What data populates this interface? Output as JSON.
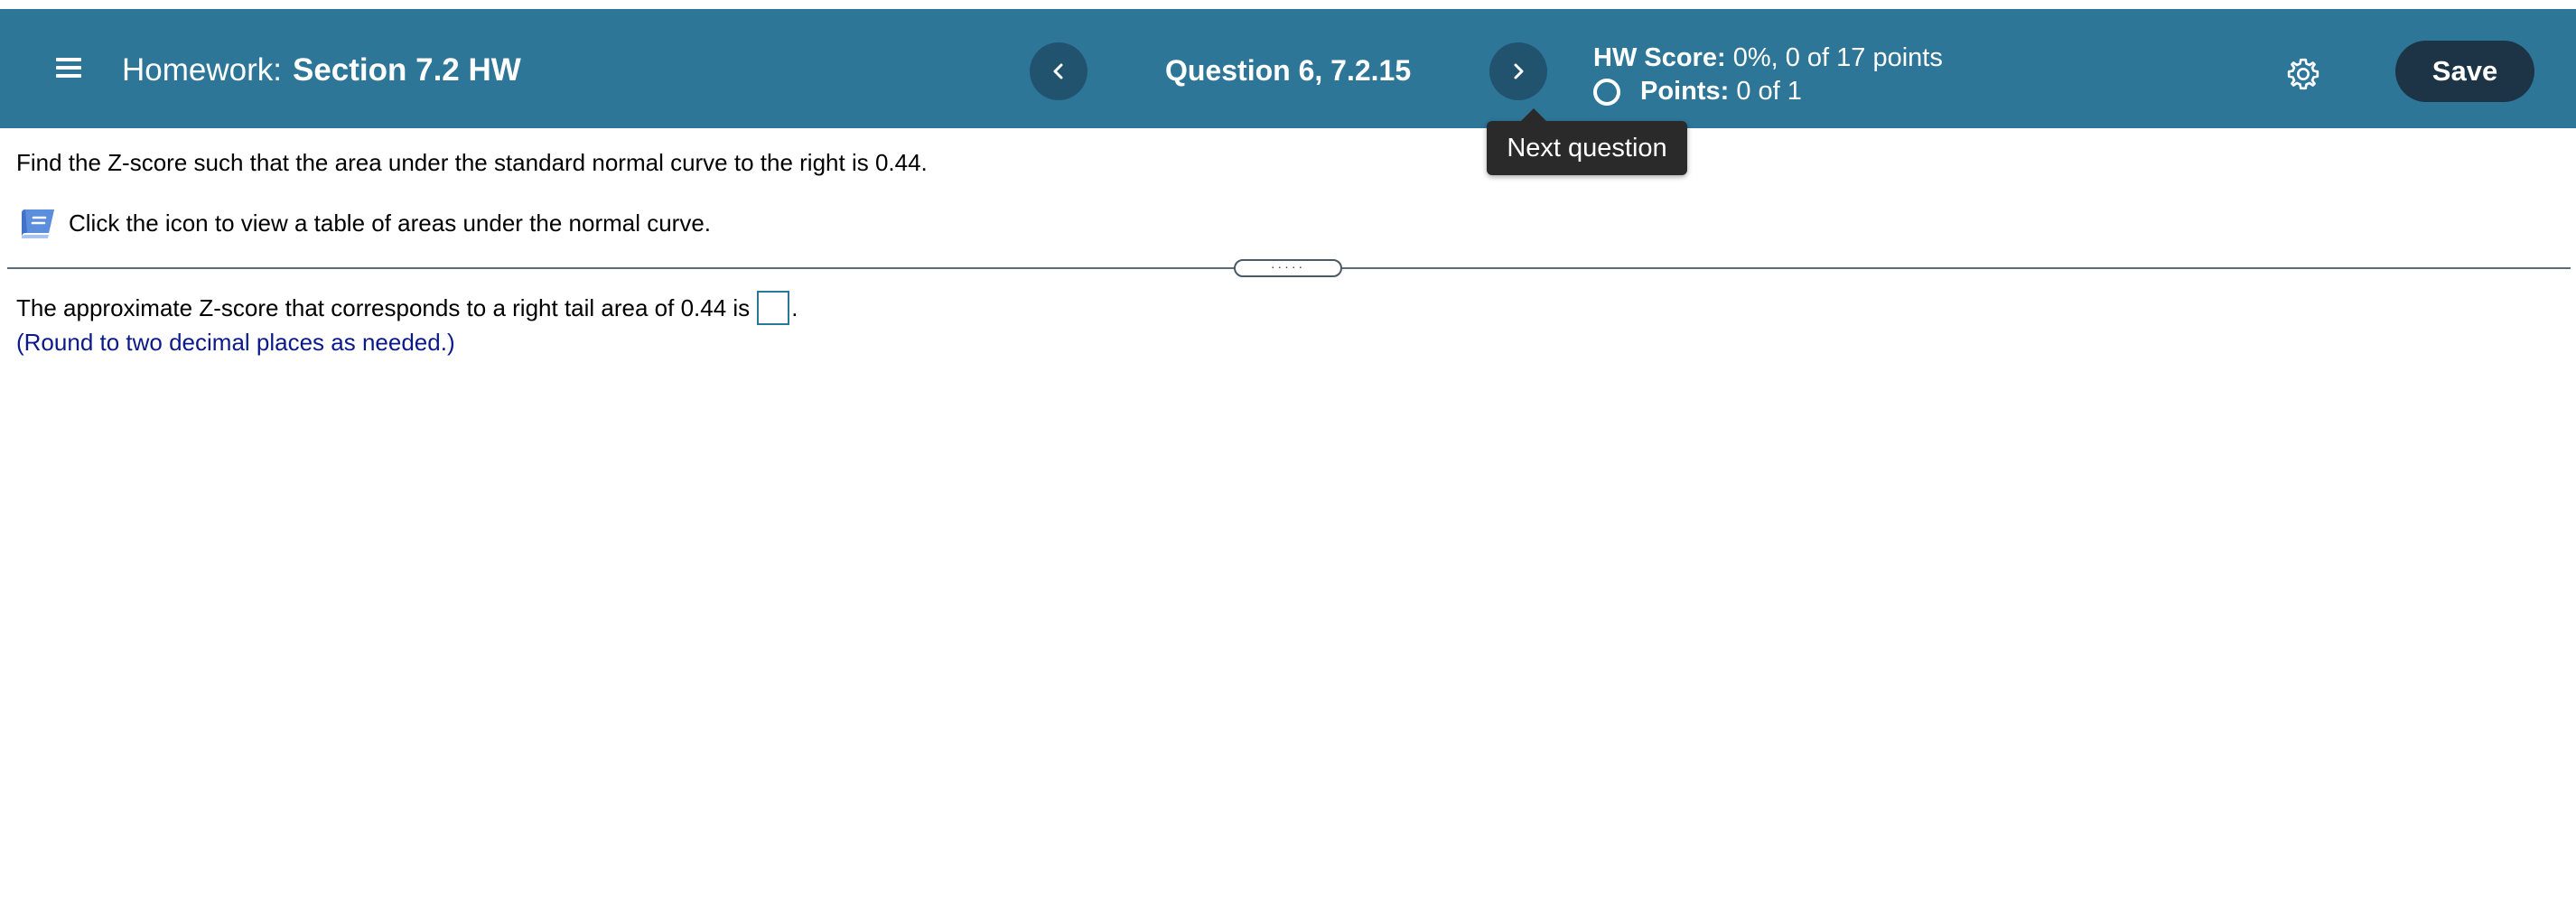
{
  "header": {
    "prefix": "Homework:",
    "title": "Section 7.2 HW",
    "question": "Question 6, 7.2.15",
    "hw_score_label": "HW Score:",
    "hw_score_value": "0%, 0 of 17 points",
    "points_label": "Points:",
    "points_value": "0 of 1",
    "save_label": "Save",
    "background_color": "#2d7698",
    "button_color": "#21536e",
    "save_color": "#1d3346"
  },
  "tooltip": {
    "text": "Next question"
  },
  "question": {
    "prompt": "Find the Z-score such that the area under the standard normal curve to the right is 0.44.",
    "table_link_text": "Click the icon to view a table of areas under the normal curve.",
    "divider_handle": "·····",
    "answer_prefix": "The approximate Z-score that corresponds to a right tail area of 0.44 is",
    "answer_suffix": ".",
    "hint": "(Round to two decimal places as needed.)",
    "hint_color": "#0a1a8a"
  },
  "icons": {
    "menu": "hamburger-menu-icon",
    "prev": "chevron-left-icon",
    "next": "chevron-right-icon",
    "settings": "gear-icon",
    "table": "book-icon",
    "status": "circle-outline-icon"
  }
}
